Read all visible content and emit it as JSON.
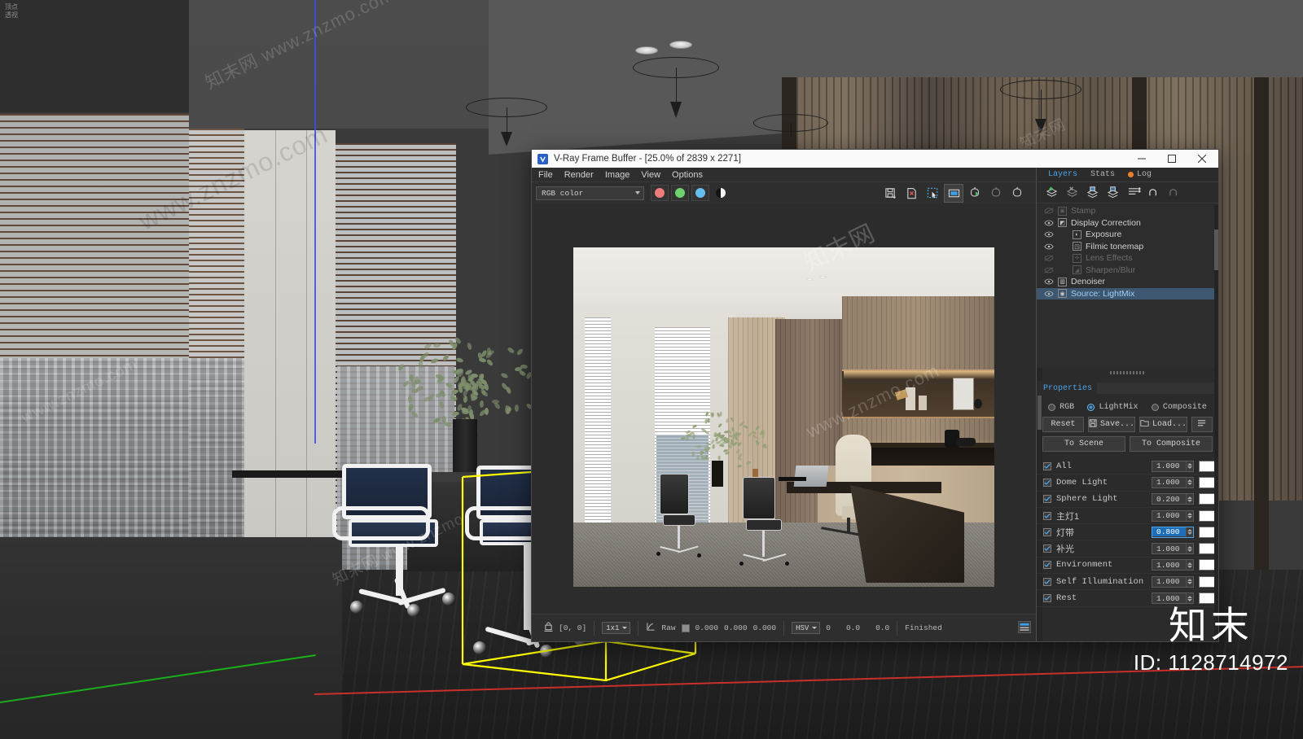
{
  "viewport": {
    "label_line1": "顶点",
    "label_line2": "透视"
  },
  "window": {
    "title": "V-Ray Frame Buffer - [25.0% of 2839 x 2271]",
    "logo_icon": "vray-logo-icon",
    "minimize": "−",
    "maximize": "▢",
    "close": "✕"
  },
  "menu": {
    "items": [
      "File",
      "Render",
      "Image",
      "View",
      "Options"
    ]
  },
  "toolbar": {
    "channel": "RGB color",
    "swatches": [
      "red-channel-icon",
      "green-channel-icon",
      "blue-channel-icon",
      "alpha-channel-icon"
    ],
    "buttons": [
      "save-image-icon",
      "save-image-vrimg-icon",
      "region-render-icon",
      "show-vfb-window-icon",
      "render-last-icon",
      "render-icon",
      "stop-render-icon"
    ]
  },
  "statusbar": {
    "pixel_coords": "[0, 0]",
    "zoom_combo": "1x1",
    "raw_label": "Raw",
    "rgb": [
      "0.000",
      "0.000",
      "0.000"
    ],
    "color_mode": "HSV",
    "hsv": [
      "0",
      "0.0",
      "0.0"
    ],
    "state": "Finished",
    "lock_icon": "lock-pixel-icon",
    "picker_icon": "color-picker-icon",
    "histogram_icon": "histogram-icon"
  },
  "panel": {
    "tabs": [
      {
        "label": "Layers",
        "active": true
      },
      {
        "label": "Stats",
        "active": false
      },
      {
        "label": "Log",
        "active": false,
        "dot": true
      }
    ],
    "layer_toolbar": [
      "add-layer-icon",
      "delete-layer-icon",
      "duplicate-layer-icon",
      "copy-layer-icon",
      "layer-list-icon",
      "undo-icon",
      "redo-icon"
    ],
    "layers": [
      {
        "name": "Stamp",
        "visible": false,
        "icon": "stamp-icon",
        "indent": 0,
        "selected": false
      },
      {
        "name": "Display Correction",
        "visible": true,
        "icon": "curve-icon",
        "indent": 0,
        "selected": false
      },
      {
        "name": "Exposure",
        "visible": true,
        "icon": "exposure-icon",
        "indent": 1,
        "selected": false
      },
      {
        "name": "Filmic tonemap",
        "visible": true,
        "icon": "filmic-icon",
        "indent": 1,
        "selected": false
      },
      {
        "name": "Lens Effects",
        "visible": false,
        "icon": "lens-effects-icon",
        "indent": 1,
        "selected": false
      },
      {
        "name": "Sharpen/Blur",
        "visible": false,
        "icon": "sharpen-blur-icon",
        "indent": 1,
        "selected": false
      },
      {
        "name": "Denoiser",
        "visible": true,
        "icon": "denoiser-icon",
        "indent": 0,
        "selected": false
      },
      {
        "name": "Source: LightMix",
        "visible": true,
        "icon": "lightmix-icon",
        "indent": 0,
        "selected": true
      }
    ],
    "properties": {
      "title": "Properties",
      "modes": [
        {
          "label": "RGB",
          "selected": false
        },
        {
          "label": "LightMix",
          "selected": true
        },
        {
          "label": "Composite",
          "selected": false
        }
      ],
      "buttons_row1": [
        {
          "label": "Reset",
          "icon": null
        },
        {
          "label": "Save...",
          "icon": "save-icon"
        },
        {
          "label": "Load...",
          "icon": "folder-icon"
        },
        {
          "label": "",
          "icon": "list-menu-icon"
        }
      ],
      "buttons_row2": [
        {
          "label": "To Scene"
        },
        {
          "label": "To Composite"
        }
      ],
      "lightmix_rows": [
        {
          "name": "All",
          "enabled": true,
          "value": "1.000",
          "editing": false,
          "color": "#ffffff",
          "cjk": false
        },
        {
          "name": "Dome Light",
          "enabled": true,
          "value": "1.000",
          "editing": false,
          "color": "#ffffff",
          "cjk": false
        },
        {
          "name": "Sphere Light",
          "enabled": true,
          "value": "0.200",
          "editing": false,
          "color": "#ffffff",
          "cjk": false
        },
        {
          "name": "主灯1",
          "enabled": true,
          "value": "1.000",
          "editing": false,
          "color": "#ffffff",
          "cjk": true
        },
        {
          "name": "灯带",
          "enabled": true,
          "value": "0.800",
          "editing": true,
          "color": "#ffffff",
          "cjk": true
        },
        {
          "name": "补光",
          "enabled": true,
          "value": "1.000",
          "editing": false,
          "color": "#ffffff",
          "cjk": true
        },
        {
          "name": "Environment",
          "enabled": true,
          "value": "1.000",
          "editing": false,
          "color": "#ffffff",
          "cjk": false
        },
        {
          "name": "Self Illumination",
          "enabled": true,
          "value": "1.000",
          "editing": false,
          "color": "#ffffff",
          "cjk": false
        },
        {
          "name": "Rest",
          "enabled": true,
          "value": "1.000",
          "editing": false,
          "color": "#ffffff",
          "cjk": false
        }
      ]
    }
  },
  "branding": {
    "name": "知末",
    "id": "ID: 1128714972",
    "watermark_text": "www.znzmo.com",
    "watermark_cn": "知末网"
  },
  "colors": {
    "accent": "#4da3e8",
    "selection": "#3e5770",
    "edit_field": "#1e6fb8",
    "log_dot": "#e8812e",
    "selection_box": "#ffff00",
    "axis_blue": "#3b4fe0",
    "axis_green": "#16b516",
    "axis_red": "#c8302a"
  }
}
